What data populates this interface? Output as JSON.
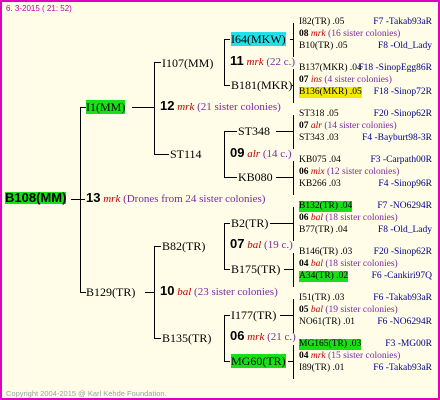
{
  "header": "6. 3-2015 ( 21: 52)",
  "root": {
    "label": "B108(MM)",
    "gen": "13",
    "mrk": "mrk",
    "note": "(Drones from 24 sister colonies)"
  },
  "top": {
    "label": "I1(MM)",
    "gen": "12",
    "mrk": "mrk",
    "note": "(21 sister colonies)"
  },
  "bottom": {
    "label": "B129(TR)",
    "gen": "10",
    "mrk": "bal",
    "note": "(23 sister colonies)"
  },
  "n_I107": {
    "label": "I107(MM)",
    "gen": "11",
    "mrk": "mrk",
    "note": "(22 c.)"
  },
  "n_ST114": {
    "label": "ST114",
    "gen": "09",
    "mrk": "alr",
    "note": "(14 c.)"
  },
  "n_B82": {
    "label": "B82(TR)",
    "gen": "07",
    "mrk": "bal",
    "note": "(19 c.)"
  },
  "n_B135": {
    "label": "B135(TR)",
    "gen": "06",
    "mrk": "mrk",
    "note": "(21 c.)"
  },
  "g_I64": "I64(MKW)",
  "g_B181": "B181(MKR)",
  "g_ST348": "ST348",
  "g_KB080": "KB080",
  "g_B2": "B2(TR)",
  "g_B175": "B175(TR)",
  "g_I177": "I177(TR)",
  "g_MG60": "MG60(TR)",
  "gg": [
    {
      "a": "I82(TR) .05",
      "ar": "F7 -Takab93aR",
      "g": "08",
      "m": "mrk",
      "n": "(16 sister colonies)",
      "b": "B10(TR) .05",
      "br": "F8 -Old_Lady"
    },
    {
      "a": "B137(MKR) .04",
      "ar": "F18 -SinopEgg86R",
      "g": "07",
      "m": "ins",
      "n": "(4 sister colonies)",
      "b": "B136(MKR) .05",
      "br": "F18 -Sinop72R"
    },
    {
      "a": "ST318 .05",
      "ar": "F20 -Sinop62R",
      "g": "07",
      "m": "alr",
      "n": "(14 sister colonies)",
      "b": "ST343 .03",
      "br": "F4 -Bayburt98-3R"
    },
    {
      "a": "KB075 .04",
      "ar": "F3 -Carpath00R",
      "g": "06",
      "m": "mix",
      "n": "(12 sister colonies)",
      "b": "KB266 .03",
      "br": "F4 -Sinop96R"
    },
    {
      "a": "B132(TR) .04",
      "ar": "F7 -NO6294R",
      "g": "06",
      "m": "bal",
      "n": "(18 sister colonies)",
      "b": "B77(TR) .04",
      "br": "F8 -Old_Lady"
    },
    {
      "a": "B146(TR) .03",
      "ar": "F20 -Sinop62R",
      "g": "04",
      "m": "bal",
      "n": "(18 sister colonies)",
      "b": "A34(TR) .02",
      "br": "F6 -Cankiri97Q"
    },
    {
      "a": "I51(TR) .03",
      "ar": "F6 -Takab93aR",
      "g": "05",
      "m": "bal",
      "n": "(19 sister colonies)",
      "b": "NO61(TR) .01",
      "br": "F6 -NO6294R"
    },
    {
      "a": "MG165(TR) .03",
      "ar": "F3 -MG00R",
      "g": "04",
      "m": "mrk",
      "n": "(15 sister colonies)",
      "b": "I89(TR) .01",
      "br": "F6 -Takab93aR"
    }
  ],
  "footer": "Copyright 2004-2015 @ Karl Kehde Foundation."
}
